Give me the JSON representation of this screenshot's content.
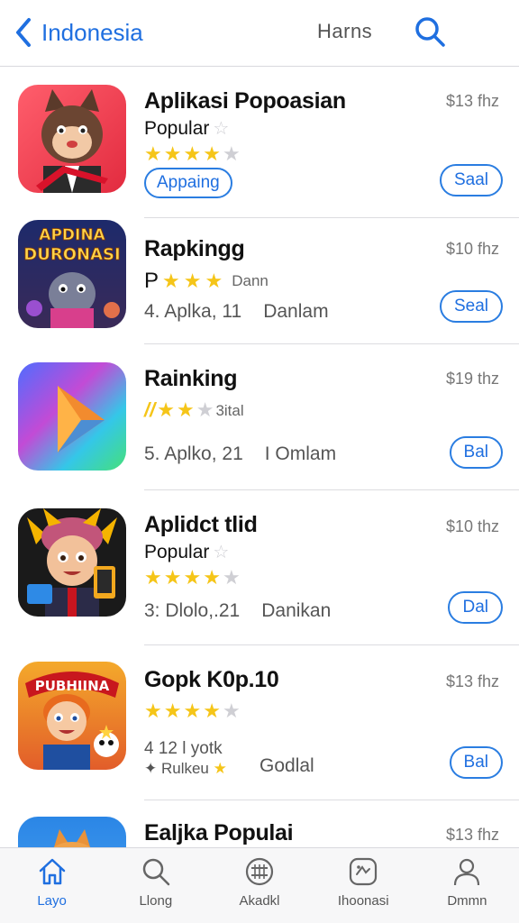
{
  "header": {
    "back_label": "Indonesia",
    "center_label": "Harns"
  },
  "apps": [
    {
      "name": "Aplikasi Popoasian",
      "price": "$13 fhz",
      "subtitle": "Popular",
      "rating": 4,
      "tag": "Appaing",
      "button": "Saal"
    },
    {
      "name": "Rapkingg",
      "price": "$10 fhz",
      "subtitle_prefix": "P",
      "rating": 3,
      "subtitle_suffix": "Dann",
      "meta_a": "4. Aplka, 11",
      "meta_b": "Danlam",
      "button": "Seal",
      "icon_text_top": "APDINA",
      "icon_text_bottom": "DURONASI"
    },
    {
      "name": "Rainking",
      "price": "$19 thz",
      "rating_prefix": "//",
      "rating": 3,
      "rating_suffix": "3ital",
      "meta_a": "5. Aplko, 21",
      "meta_b": "I Omlam",
      "button": "Bal"
    },
    {
      "name": "Aplidct tlid",
      "price": "$10 thz",
      "subtitle": "Popular",
      "rating": 4,
      "meta_a": "3: Dlolo,.21",
      "meta_b": "Danikan",
      "button": "Dal"
    },
    {
      "name": "Gopk K0p.10",
      "price": "$13 fhz",
      "rating": 4,
      "meta_a": "4 12 l yotk",
      "meta_c": "Rulkeu",
      "meta_b": "Godlal",
      "button": "Bal",
      "icon_text_top": "PUBHIINA"
    },
    {
      "name": "Ealjka Populai",
      "price": "$13 fhz"
    }
  ],
  "tabbar": [
    {
      "label": "Layo",
      "icon": "home-icon",
      "active": true
    },
    {
      "label": "Llong",
      "icon": "search-icon",
      "active": false
    },
    {
      "label": "Akadkl",
      "icon": "apps-icon",
      "active": false
    },
    {
      "label": "Ihoonasi",
      "icon": "games-icon",
      "active": false
    },
    {
      "label": "Dmmn",
      "icon": "person-icon",
      "active": false
    }
  ],
  "colors": {
    "accent": "#1f6fe0",
    "star": "#f5c518",
    "star_empty": "#cfcfd4",
    "divider": "#dcdce0"
  }
}
